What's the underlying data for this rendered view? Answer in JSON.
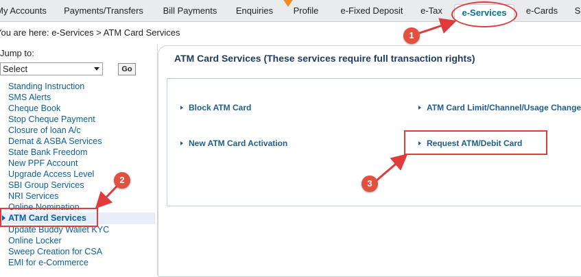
{
  "nav": {
    "tabs": [
      {
        "label": "My Accounts"
      },
      {
        "label": "Payments/Transfers"
      },
      {
        "label": "Bill Payments"
      },
      {
        "label": "Enquiries"
      },
      {
        "label": "Profile"
      },
      {
        "label": "e-Fixed Deposit"
      },
      {
        "label": "e-Tax"
      },
      {
        "label": "e-Services"
      },
      {
        "label": "e-Cards"
      },
      {
        "label": "S"
      }
    ],
    "active": "e-Services"
  },
  "breadcrumb": {
    "lead": "You are here:",
    "path": "e-Services > ATM Card Services"
  },
  "jump": {
    "label": "Jump to:",
    "selected": "Select",
    "go_label": "Go"
  },
  "sidebar": {
    "items": [
      {
        "label": "Standing Instruction"
      },
      {
        "label": "SMS Alerts"
      },
      {
        "label": "Cheque Book"
      },
      {
        "label": "Stop Cheque Payment"
      },
      {
        "label": "Closure of loan A/c"
      },
      {
        "label": "Demat & ASBA Services"
      },
      {
        "label": "State Bank Freedom"
      },
      {
        "label": "New PPF Account"
      },
      {
        "label": "Upgrade Access Level"
      },
      {
        "label": "SBI Group Services"
      },
      {
        "label": "NRI Services"
      },
      {
        "label": "Online Nomination"
      },
      {
        "label": "ATM Card Services"
      },
      {
        "label": "Update Buddy Wallet KYC"
      },
      {
        "label": "Online Locker"
      },
      {
        "label": "Sweep Creation for CSA"
      },
      {
        "label": "EMI for e-Commerce"
      }
    ],
    "selected": "ATM Card Services"
  },
  "main": {
    "title": "ATM Card Services (These services require full transaction rights)",
    "links": {
      "block": "Block ATM Card",
      "limit": "ATM Card Limit/Channel/Usage Change",
      "activation": "New ATM Card Activation",
      "request": "Request ATM/Debit Card"
    }
  },
  "annotations": {
    "badge1": "1",
    "badge2": "2",
    "badge3": "3",
    "color": "#e03a3a"
  },
  "colors": {
    "link": "#1e5d8c",
    "sidebar_link": "#0e5f97",
    "active_tab": "#0e6e8e",
    "marker": "#f08a24"
  }
}
